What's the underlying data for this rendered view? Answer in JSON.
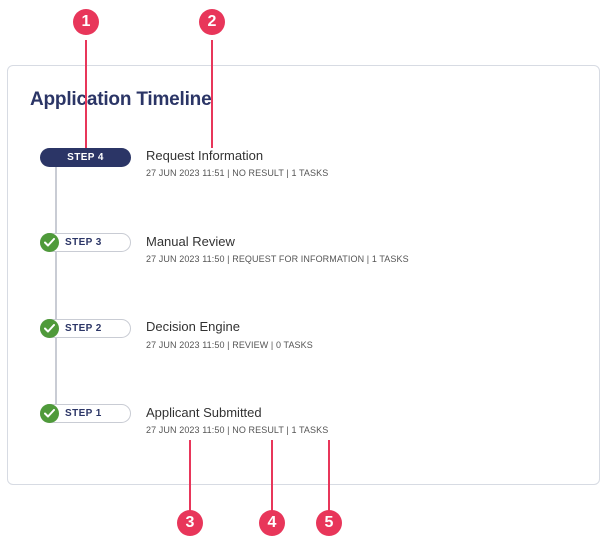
{
  "timeline": {
    "title": "Application Timeline",
    "steps": [
      {
        "label": "STEP 4",
        "title": "Request Information",
        "meta": "27 JUN 2023 11:51 | NO RESULT | 1 TASKS",
        "status": "current"
      },
      {
        "label": "STEP 3",
        "title": "Manual Review",
        "meta": "27 JUN 2023 11:50 | REQUEST FOR INFORMATION | 1 TASKS",
        "status": "complete"
      },
      {
        "label": "STEP 2",
        "title": "Decision Engine",
        "meta": "27 JUN 2023 11:50 | REVIEW | 0 TASKS",
        "status": "complete"
      },
      {
        "label": "STEP 1",
        "title": "Applicant Submitted",
        "meta": "27 JUN 2023 11:50 | NO RESULT | 1 TASKS",
        "status": "complete"
      }
    ]
  },
  "annotations": [
    "1",
    "2",
    "3",
    "4",
    "5"
  ],
  "colors": {
    "primary": "#2b3566",
    "success": "#4f9a3a",
    "annotation": "#e8365a"
  }
}
